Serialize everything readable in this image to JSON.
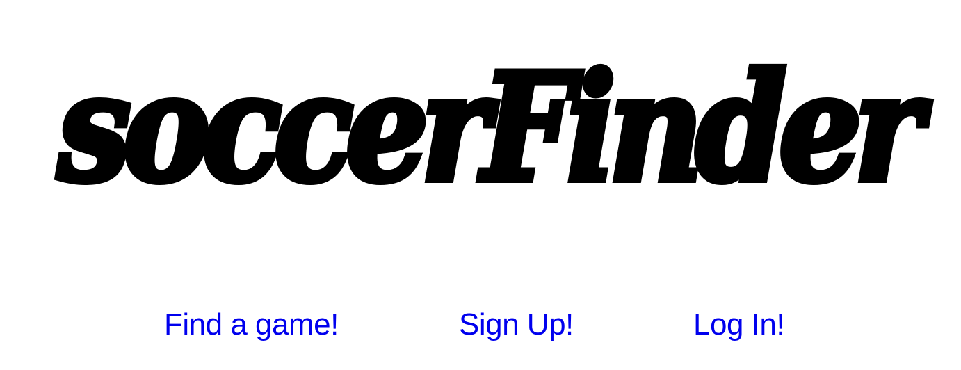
{
  "logo": {
    "text": "soccerFinder"
  },
  "nav": {
    "links": [
      {
        "label": "Find a game!"
      },
      {
        "label": "Sign Up!"
      },
      {
        "label": "Log In!"
      }
    ]
  },
  "colors": {
    "background": "#ffffff",
    "logo": "#000000",
    "link": "#0000ee"
  }
}
